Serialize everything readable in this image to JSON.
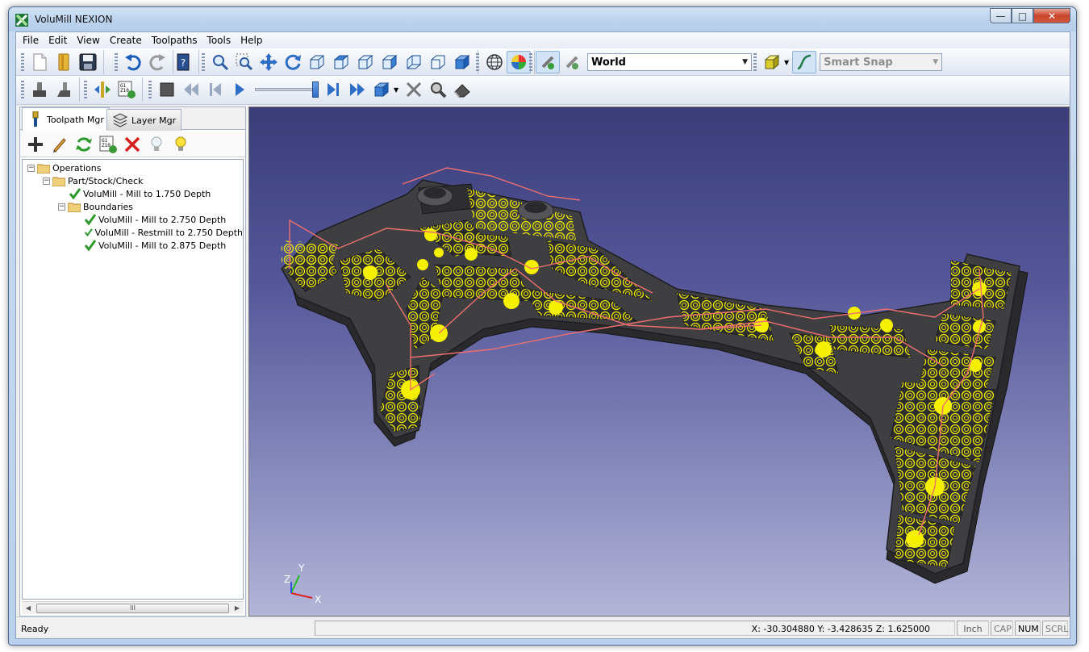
{
  "window": {
    "title": "VoluMill NEXION"
  },
  "menu": [
    "File",
    "Edit",
    "View",
    "Create",
    "Toolpaths",
    "Tools",
    "Help"
  ],
  "toolbar": {
    "view_select": "World",
    "snap_select": "Smart Snap"
  },
  "panel": {
    "tabs": [
      "Toolpath Mgr",
      "Layer Mgr"
    ],
    "tree": {
      "root": "Operations",
      "group1": "Part/Stock/Check",
      "op1": "VoluMill - Mill to 1.750 Depth",
      "group2": "Boundaries",
      "op2": "VoluMill - Mill to 2.750 Depth",
      "op3": "VoluMill - Restmill to 2.750 Depth",
      "op4": "VoluMill - Mill to 2.875 Depth"
    },
    "scroll_thumb": "III"
  },
  "triad": {
    "x": "X",
    "y": "Y",
    "z": "Z"
  },
  "status": {
    "message": "Ready",
    "coords": "X: -30.304880 Y: -3.428635 Z: 1.625000",
    "units": "Inch",
    "cap": "CAP",
    "num": "NUM",
    "scrl": "SCRL"
  },
  "colors": {
    "toolpath": "#f4f000",
    "rapid": "#ee6f6f",
    "part": "#3f3f41",
    "viewport_top": "#3a3d78",
    "viewport_bottom": "#b3b5d8"
  }
}
